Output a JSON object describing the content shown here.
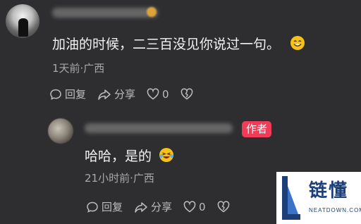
{
  "comment": {
    "text": "加油的时候，二三百没见你说过一句。",
    "meta": "1天前·广西",
    "actions": {
      "reply": "回复",
      "share": "分享",
      "likes": "0"
    }
  },
  "reply": {
    "author_badge": "作者",
    "text": "哈哈，是的",
    "meta": "21小时前·广西",
    "actions": {
      "reply": "回复",
      "share": "分享",
      "likes": "0"
    }
  },
  "watermark": {
    "title": "链懂",
    "sub": "NEATDOWN.COM"
  },
  "colors": {
    "background": "#2e2e30",
    "badge": "#f23b58"
  }
}
